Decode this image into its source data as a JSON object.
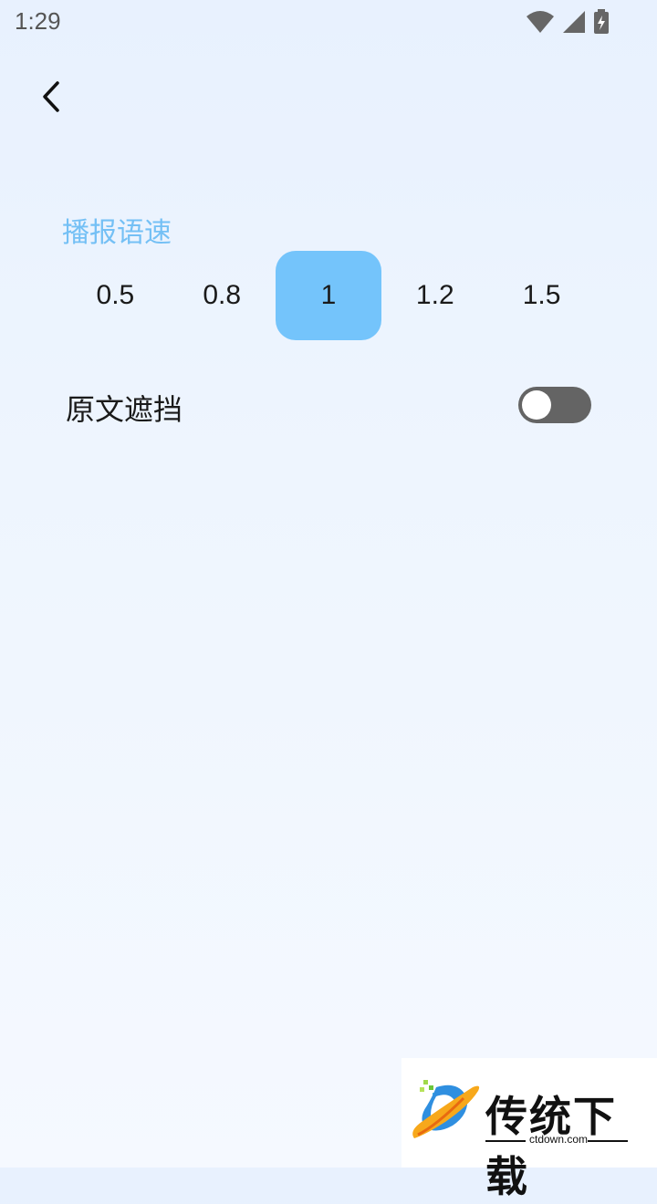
{
  "status_bar": {
    "time": "1:29"
  },
  "header": {
    "back_icon": "chevron-left-icon"
  },
  "speech_speed": {
    "title": "播报语速",
    "options": [
      "0.5",
      "0.8",
      "1",
      "1.2",
      "1.5"
    ],
    "selected": "1",
    "selected_color": "#74c4fb",
    "title_color": "#74c0f5"
  },
  "text_mask": {
    "label": "原文遮挡",
    "enabled": false
  },
  "watermark": {
    "name": "传统下载",
    "url": "ctdown.com"
  }
}
